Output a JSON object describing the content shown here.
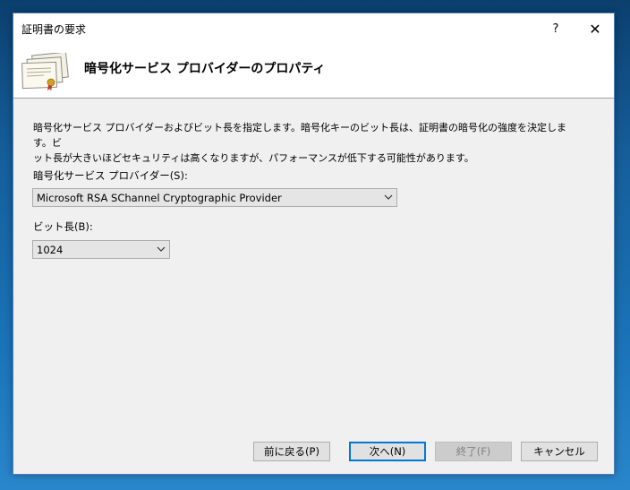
{
  "window": {
    "title": "証明書の要求",
    "help_glyph": "?",
    "close_glyph": "✕"
  },
  "header": {
    "title": "暗号化サービス プロバイダーのプロパティ",
    "icon": "certificate-stack-icon"
  },
  "content": {
    "description_line1": "暗号化サービス プロバイダーおよびビット長を指定します。暗号化キーのビット長は、証明書の暗号化の強度を決定します。ビ",
    "description_line2": "ット長が大きいほどセキュリティは高くなりますが、パフォーマンスが低下する可能性があります。",
    "csp_label": "暗号化サービス プロバイダー(S):",
    "csp_value": "Microsoft RSA SChannel Cryptographic Provider",
    "bitlength_label": "ビット長(B):",
    "bitlength_value": "1024"
  },
  "buttons": {
    "back": "前に戻る(P)",
    "next": "次へ(N)",
    "finish": "終了(F)",
    "cancel": "キャンセル"
  }
}
